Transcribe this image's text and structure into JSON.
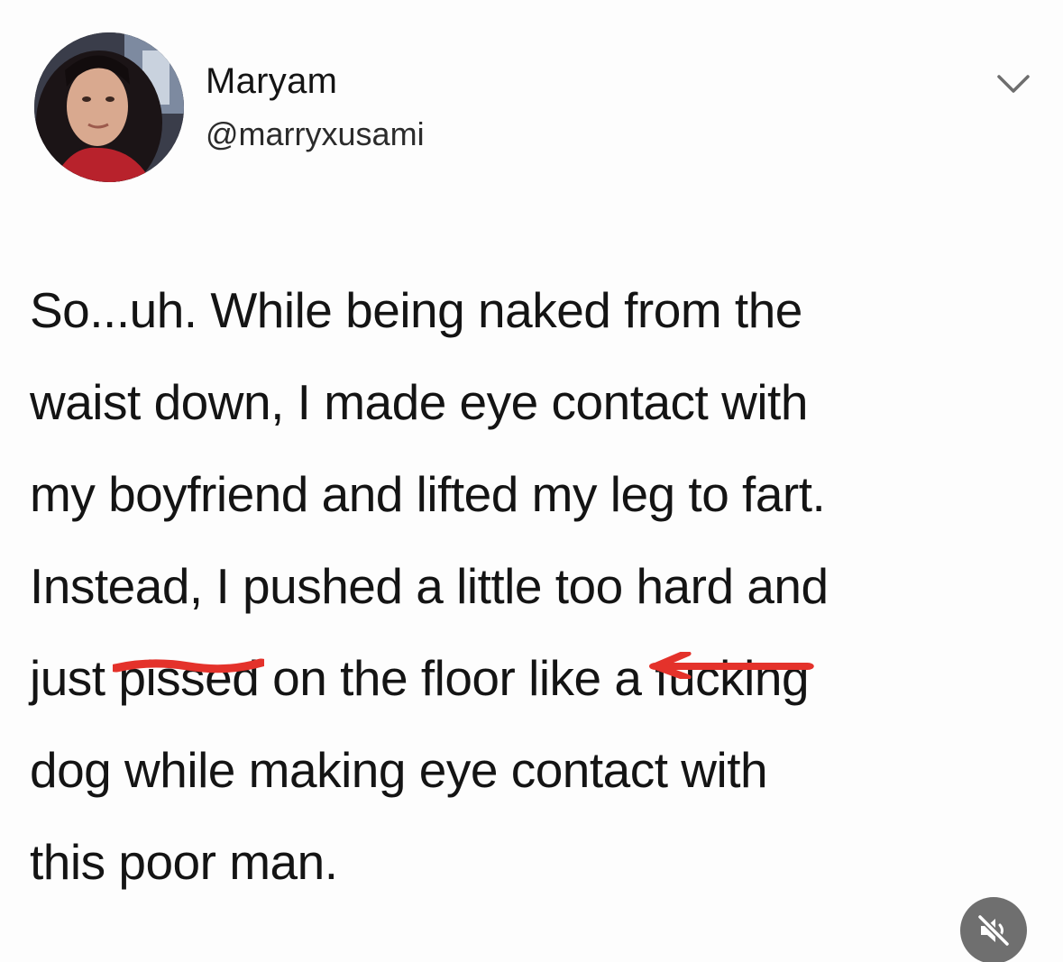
{
  "user": {
    "display_name": "Maryam",
    "handle": "@marryxusami"
  },
  "icons": {
    "menu": "chevron-down-icon",
    "mute": "speaker-muted-icon"
  },
  "colors": {
    "redaction": "#e4322b",
    "mute_button": "#6f6f6f"
  },
  "tweet": {
    "line1": "So...uh. While being naked from the",
    "line2": "waist down, I made eye contact with",
    "line3": "my boyfriend and lifted my leg to fart.",
    "line4": "Instead, I pushed a little too hard and",
    "line5_a": "just ",
    "line5_redacted1": "pissed",
    "line5_b": " on the floor like a ",
    "line5_redacted2": "fucking",
    "line6": "dog while making eye contact with",
    "line7": "this poor man."
  }
}
